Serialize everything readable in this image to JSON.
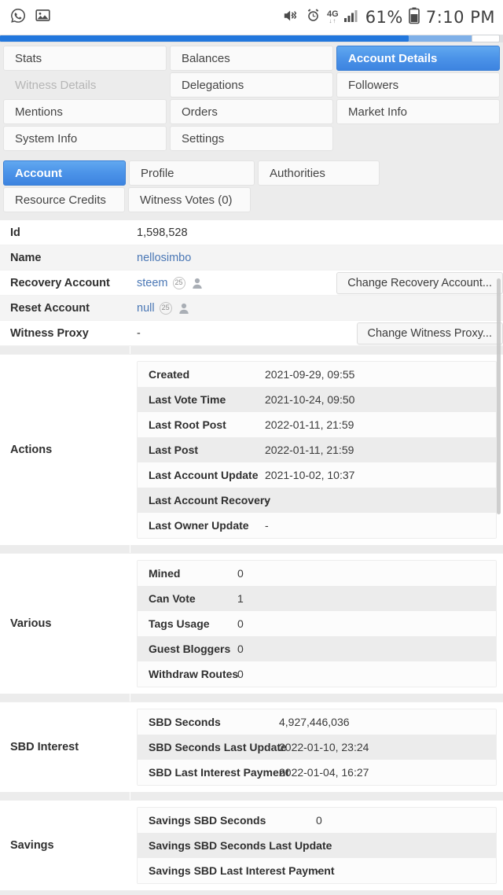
{
  "statusbar": {
    "left_icons": [
      "whatsapp-icon",
      "gallery-icon"
    ],
    "right_icons": [
      "mute-vibrate-icon",
      "alarm-icon",
      "network-4g-icon",
      "signal-bars-icon",
      "battery-icon"
    ],
    "network_label": "4G",
    "battery_percent": "61%",
    "time": "7:10 PM"
  },
  "browserbar": {
    "progress_percent": 81
  },
  "tabs": {
    "primary": [
      {
        "label": "Stats",
        "state": "normal"
      },
      {
        "label": "Balances",
        "state": "normal"
      },
      {
        "label": "Account Details",
        "state": "active"
      },
      {
        "label": "Witness Details",
        "state": "disabled"
      },
      {
        "label": "Delegations",
        "state": "normal"
      },
      {
        "label": "Followers",
        "state": "normal"
      },
      {
        "label": "Mentions",
        "state": "normal"
      },
      {
        "label": "Orders",
        "state": "normal"
      },
      {
        "label": "Market Info",
        "state": "normal"
      },
      {
        "label": "System Info",
        "state": "normal"
      },
      {
        "label": "Settings",
        "state": "normal"
      },
      {
        "label": "",
        "state": "empty"
      }
    ],
    "secondary": [
      {
        "label": "Account",
        "state": "active"
      },
      {
        "label": "Profile",
        "state": "normal"
      },
      {
        "label": "Authorities",
        "state": "normal"
      },
      {
        "label": "Resource Credits",
        "state": "normal"
      },
      {
        "label": "Witness Votes (0)",
        "state": "normal"
      }
    ]
  },
  "account": {
    "rows": [
      {
        "key": "Id",
        "value": "1,598,528",
        "type": "text"
      },
      {
        "key": "Name",
        "value": "nellosimbo",
        "type": "link"
      },
      {
        "key": "Recovery Account",
        "value": "steem",
        "type": "account",
        "reputation": "25",
        "button": "Change Recovery Account..."
      },
      {
        "key": "Reset Account",
        "value": "null",
        "type": "account",
        "reputation": "25"
      },
      {
        "key": "Witness Proxy",
        "value": "-",
        "type": "text",
        "button": "Change Witness Proxy..."
      }
    ]
  },
  "sections": [
    {
      "label": "Actions",
      "rows": [
        {
          "key": "Created",
          "value": "2021-09-29, 09:55"
        },
        {
          "key": "Last Vote Time",
          "value": "2021-10-24, 09:50"
        },
        {
          "key": "Last Root Post",
          "value": "2022-01-11, 21:59"
        },
        {
          "key": "Last Post",
          "value": "2022-01-11, 21:59"
        },
        {
          "key": "Last Account Update",
          "value": "2021-10-02, 10:37"
        },
        {
          "key": "Last Account Recovery",
          "value": "-"
        },
        {
          "key": "Last Owner Update",
          "value": "-"
        }
      ]
    },
    {
      "label": "Various",
      "rows": [
        {
          "key": "Mined",
          "value": "0"
        },
        {
          "key": "Can Vote",
          "value": "1"
        },
        {
          "key": "Tags Usage",
          "value": "0"
        },
        {
          "key": "Guest Bloggers",
          "value": "0"
        },
        {
          "key": "Withdraw Routes",
          "value": "0"
        }
      ]
    },
    {
      "label": "SBD Interest",
      "rows": [
        {
          "key": "SBD Seconds",
          "value": "4,927,446,036"
        },
        {
          "key": "SBD Seconds Last Update",
          "value": "2022-01-10, 23:24"
        },
        {
          "key": "SBD Last Interest Payment",
          "value": "2022-01-04, 16:27"
        }
      ]
    },
    {
      "label": "Savings",
      "rows": [
        {
          "key": "Savings SBD Seconds",
          "value": "0"
        },
        {
          "key": "Savings SBD Seconds Last Update",
          "value": "-"
        },
        {
          "key": "Savings SBD Last Interest Payment",
          "value": "-"
        }
      ]
    }
  ],
  "colors": {
    "accent_blue": "#4b93e8",
    "link_blue": "#4a77b5",
    "page_bg": "#ececec",
    "row_alt": "#f4f4f4",
    "progress_blue": "#2277dd"
  }
}
